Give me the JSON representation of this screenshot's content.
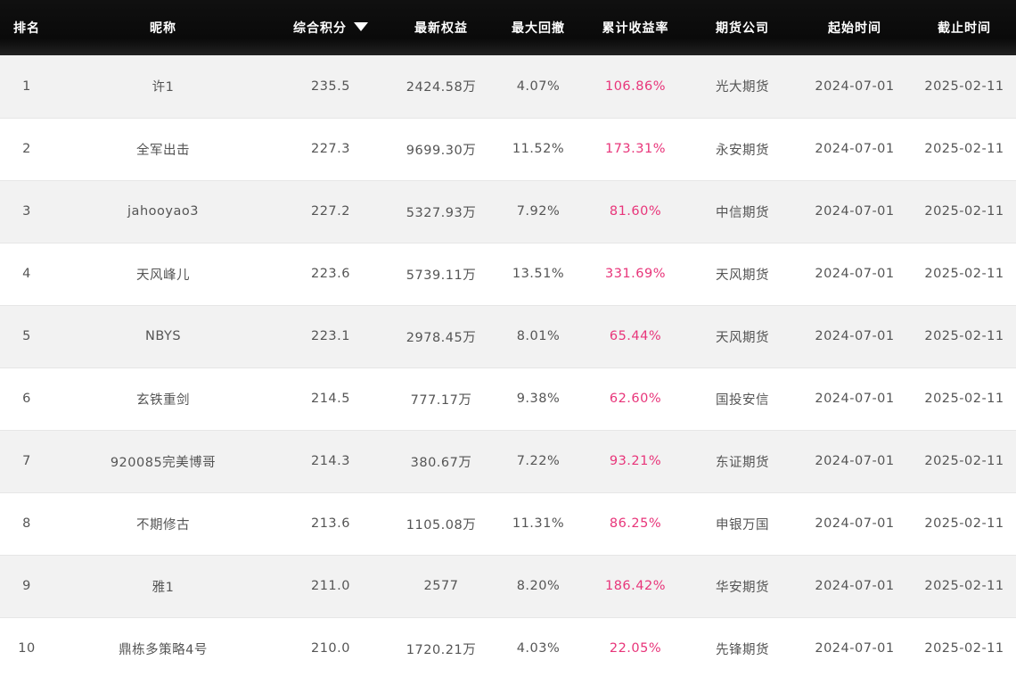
{
  "headers": {
    "rank": "排名",
    "nickname": "昵称",
    "score": "综合积分",
    "equity": "最新权益",
    "drawdown": "最大回撤",
    "cum_return": "累计收益率",
    "broker": "期货公司",
    "start": "起始时间",
    "end": "截止时间"
  },
  "colors": {
    "header_bg": "#0a0a0a",
    "return_color": "#e8357a",
    "row_alt_bg": "#f2f2f2"
  },
  "sort": {
    "column": "score",
    "direction": "desc",
    "icon": "sort-down-icon"
  },
  "rows": [
    {
      "rank": "1",
      "nickname": "许1",
      "score": "235.5",
      "equity": "2424.58万",
      "drawdown": "4.07%",
      "cum_return": "106.86%",
      "broker": "光大期货",
      "start": "2024-07-01",
      "end": "2025-02-11"
    },
    {
      "rank": "2",
      "nickname": "全军出击",
      "score": "227.3",
      "equity": "9699.30万",
      "drawdown": "11.52%",
      "cum_return": "173.31%",
      "broker": "永安期货",
      "start": "2024-07-01",
      "end": "2025-02-11"
    },
    {
      "rank": "3",
      "nickname": "jahooyao3",
      "score": "227.2",
      "equity": "5327.93万",
      "drawdown": "7.92%",
      "cum_return": "81.60%",
      "broker": "中信期货",
      "start": "2024-07-01",
      "end": "2025-02-11"
    },
    {
      "rank": "4",
      "nickname": "天风峰儿",
      "score": "223.6",
      "equity": "5739.11万",
      "drawdown": "13.51%",
      "cum_return": "331.69%",
      "broker": "天风期货",
      "start": "2024-07-01",
      "end": "2025-02-11"
    },
    {
      "rank": "5",
      "nickname": "NBYS",
      "score": "223.1",
      "equity": "2978.45万",
      "drawdown": "8.01%",
      "cum_return": "65.44%",
      "broker": "天风期货",
      "start": "2024-07-01",
      "end": "2025-02-11"
    },
    {
      "rank": "6",
      "nickname": "玄铁重剑",
      "score": "214.5",
      "equity": "777.17万",
      "drawdown": "9.38%",
      "cum_return": "62.60%",
      "broker": "国投安信",
      "start": "2024-07-01",
      "end": "2025-02-11"
    },
    {
      "rank": "7",
      "nickname": "920085完美博哥",
      "score": "214.3",
      "equity": "380.67万",
      "drawdown": "7.22%",
      "cum_return": "93.21%",
      "broker": "东证期货",
      "start": "2024-07-01",
      "end": "2025-02-11"
    },
    {
      "rank": "8",
      "nickname": "不期修古",
      "score": "213.6",
      "equity": "1105.08万",
      "drawdown": "11.31%",
      "cum_return": "86.25%",
      "broker": "申银万国",
      "start": "2024-07-01",
      "end": "2025-02-11"
    },
    {
      "rank": "9",
      "nickname": "雅1",
      "score": "211.0",
      "equity": "2577",
      "drawdown": "8.20%",
      "cum_return": "186.42%",
      "broker": "华安期货",
      "start": "2024-07-01",
      "end": "2025-02-11"
    },
    {
      "rank": "10",
      "nickname": "鼎栋多策略4号",
      "score": "210.0",
      "equity": "1720.21万",
      "drawdown": "4.03%",
      "cum_return": "22.05%",
      "broker": "先锋期货",
      "start": "2024-07-01",
      "end": "2025-02-11"
    }
  ]
}
